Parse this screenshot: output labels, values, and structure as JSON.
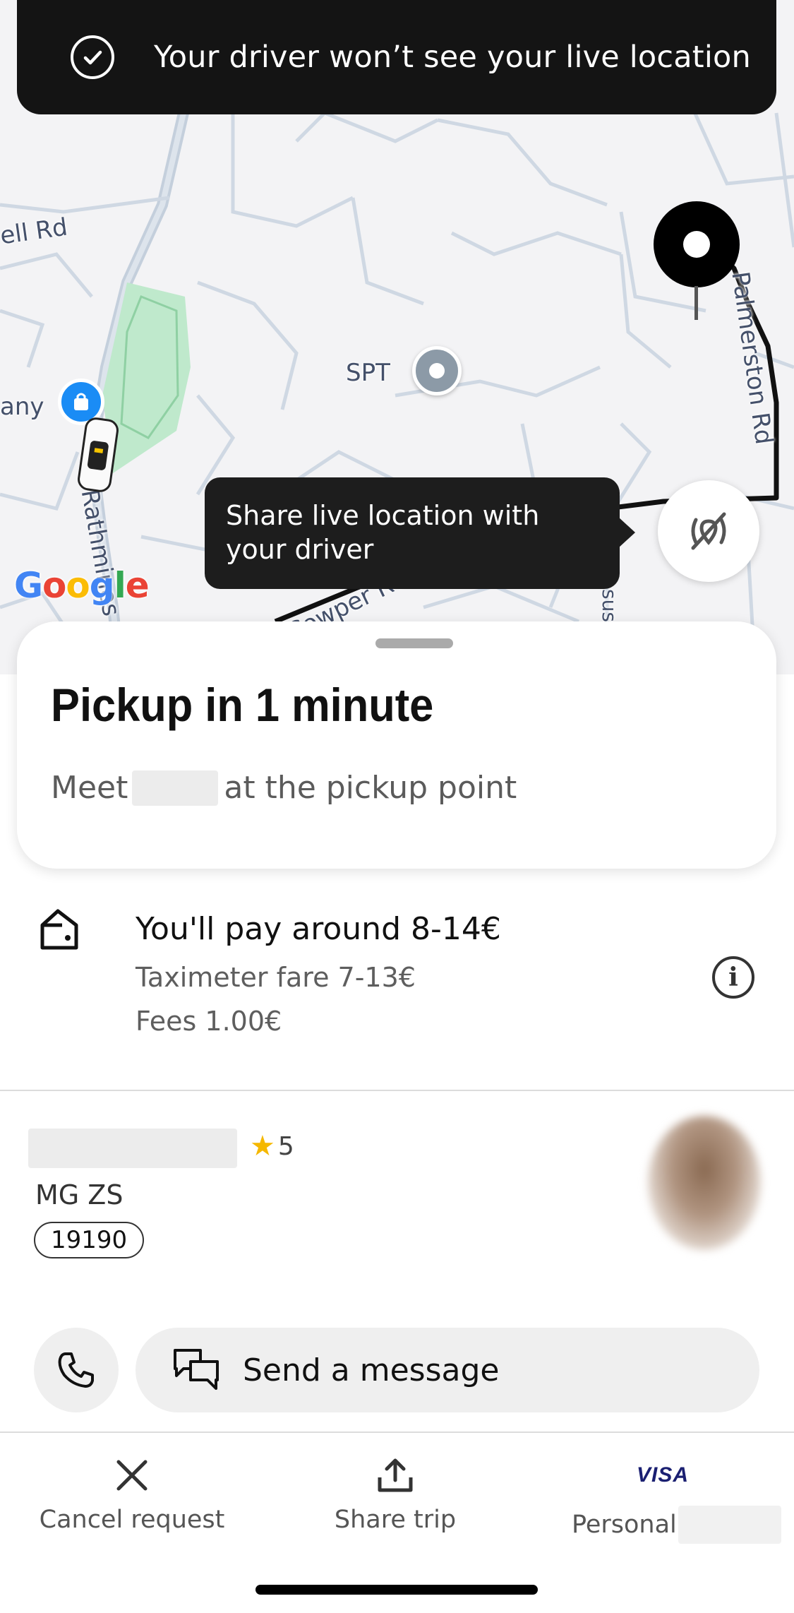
{
  "toast": {
    "text": "Your driver won’t see your live location",
    "icon": "check-circle-icon"
  },
  "map": {
    "labels": {
      "street_1": "ell Rd",
      "place_1": "any",
      "spt": "SPT",
      "street_2": "Rathmines Rd",
      "street_3": "Cowper Rd",
      "street_4": "Palmerston Rd",
      "street_5": "sus"
    },
    "google_logo": [
      "G",
      "o",
      "o",
      "g",
      "l",
      "e"
    ],
    "tooltip": "Share live location with your driver",
    "live_location_icon": "location-off-icon"
  },
  "pickup": {
    "title": "Pickup in 1 minute",
    "subtitle_before": "Meet",
    "subtitle_after": "at the pickup point"
  },
  "fare": {
    "main": "You'll pay around 8-14€",
    "taximeter": "Taximeter fare 7-13€",
    "fees": "Fees 1.00€",
    "info_icon": "info-icon"
  },
  "driver": {
    "rating": "5",
    "car_model": "MG ZS",
    "plate": "19190"
  },
  "actions": {
    "message": "Send a message"
  },
  "bottom_bar": {
    "cancel": "Cancel request",
    "share": "Share trip",
    "payment_label": "Personal",
    "card_brand": "VISA"
  },
  "colors": {
    "accent_blue": "#1a8cf5",
    "card_dark": "#141414",
    "star": "#f5b800",
    "visa_blue": "#1a1f71"
  }
}
